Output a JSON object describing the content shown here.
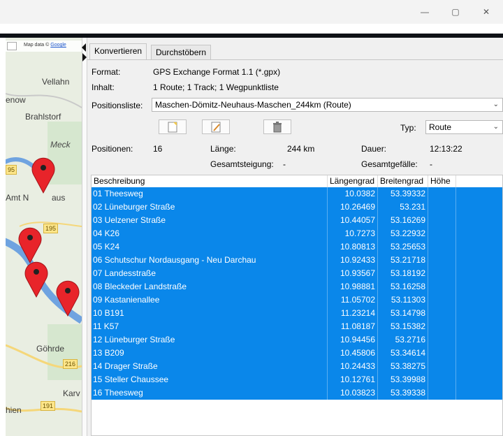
{
  "window": {
    "controls": [
      "—",
      "▢",
      "✕"
    ]
  },
  "map": {
    "attribution_prefix": "Map data ©",
    "attribution_link": "Google",
    "places": [
      "Vellahn",
      "enow",
      "Brahlstorf",
      "Meck",
      "Amt N",
      "aus",
      "Göhrde",
      "Karv",
      "hien"
    ],
    "road_numbers": [
      "95",
      "195",
      "216",
      "191"
    ]
  },
  "tabs": [
    "Konvertieren",
    "Durchstöbern"
  ],
  "info": {
    "format_label": "Format:",
    "format_value": "GPS Exchange Format 1.1 (*.gpx)",
    "inhalt_label": "Inhalt:",
    "inhalt_value": "1 Route; 1 Track; 1 Wegpunktliste",
    "positionsliste_label": "Positionsliste:",
    "positionsliste_value": "Maschen-Dömitz-Neuhaus-Maschen_244km (Route)",
    "typ_label": "Typ:",
    "typ_value": "Route",
    "positionen_label": "Positionen:",
    "positionen_value": "16",
    "laenge_label": "Länge:",
    "laenge_value": "244 km",
    "dauer_label": "Dauer:",
    "dauer_value": "12:13:22",
    "steigung_label": "Gesamtsteigung:",
    "steigung_value": "-",
    "gefaelle_label": "Gesamtgefälle:",
    "gefaelle_value": "-"
  },
  "toolbar": {
    "icons": [
      "new-document-icon",
      "edit-document-icon",
      "trash-icon"
    ]
  },
  "table": {
    "columns": [
      "Beschreibung",
      "Längengrad",
      "Breitengrad",
      "Höhe"
    ],
    "rows": [
      {
        "name": "01 Theesweg",
        "lon": "10.0382",
        "lat": "53.39332",
        "alt": ""
      },
      {
        "name": "02 Lüneburger Straße",
        "lon": "10.26469",
        "lat": "53.231",
        "alt": ""
      },
      {
        "name": "03 Uelzener Straße",
        "lon": "10.44057",
        "lat": "53.16269",
        "alt": ""
      },
      {
        "name": "04 K26",
        "lon": "10.7273",
        "lat": "53.22932",
        "alt": ""
      },
      {
        "name": "05 K24",
        "lon": "10.80813",
        "lat": "53.25653",
        "alt": ""
      },
      {
        "name": "06 Schutschur Nordausgang - Neu Darchau",
        "lon": "10.92433",
        "lat": "53.21718",
        "alt": ""
      },
      {
        "name": "07 Landesstraße",
        "lon": "10.93567",
        "lat": "53.18192",
        "alt": ""
      },
      {
        "name": "08 Bleckeder Landstraße",
        "lon": "10.98881",
        "lat": "53.16258",
        "alt": ""
      },
      {
        "name": "09 Kastanienallee",
        "lon": "11.05702",
        "lat": "53.11303",
        "alt": ""
      },
      {
        "name": "10 B191",
        "lon": "11.23214",
        "lat": "53.14798",
        "alt": ""
      },
      {
        "name": "11 K57",
        "lon": "11.08187",
        "lat": "53.15382",
        "alt": ""
      },
      {
        "name": "12 Lüneburger Straße",
        "lon": "10.94456",
        "lat": "53.2716",
        "alt": ""
      },
      {
        "name": "13 B209",
        "lon": "10.45806",
        "lat": "53.34614",
        "alt": ""
      },
      {
        "name": "14 Drager Straße",
        "lon": "10.24433",
        "lat": "53.38275",
        "alt": ""
      },
      {
        "name": "15 Steller Chaussee",
        "lon": "10.12761",
        "lat": "53.39988",
        "alt": ""
      },
      {
        "name": "16 Theesweg",
        "lon": "10.03823",
        "lat": "53.39338",
        "alt": ""
      }
    ]
  },
  "colors": {
    "selection": "#0a87ea",
    "marker": "#e8242a",
    "river": "#6fa3e0",
    "map_bg": "#e9eee2"
  }
}
